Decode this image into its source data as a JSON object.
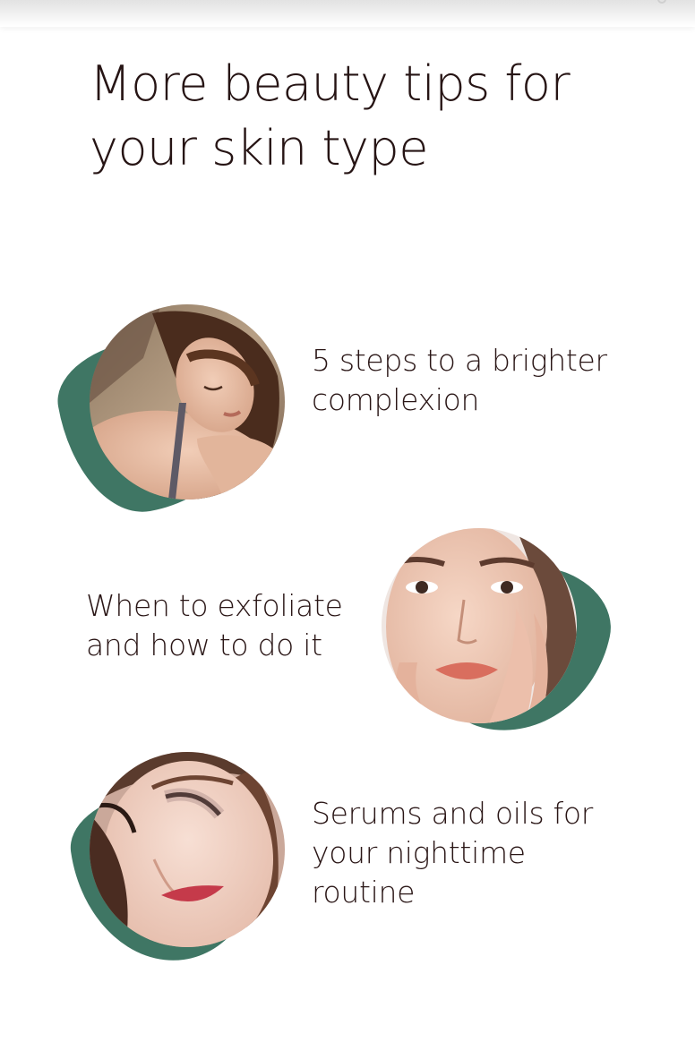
{
  "header": {
    "title_line1": "More beauty tips for",
    "title_line2": "your skin type"
  },
  "tips": [
    {
      "label_lines": [
        "5 steps to a brighter",
        "complexion"
      ],
      "image": "woman-resting-on-arm-photo"
    },
    {
      "label_lines": [
        "When to exfoliate",
        "and how to do it"
      ],
      "image": "woman-hand-on-face-photo"
    },
    {
      "label_lines": [
        "Serums and oils for",
        "your nighttime",
        "routine"
      ],
      "image": "woman-eyes-closed-makeup-photo"
    }
  ],
  "colors": {
    "accent_blob": "#3f7664",
    "text": "#261414",
    "background": "#ffffff"
  }
}
